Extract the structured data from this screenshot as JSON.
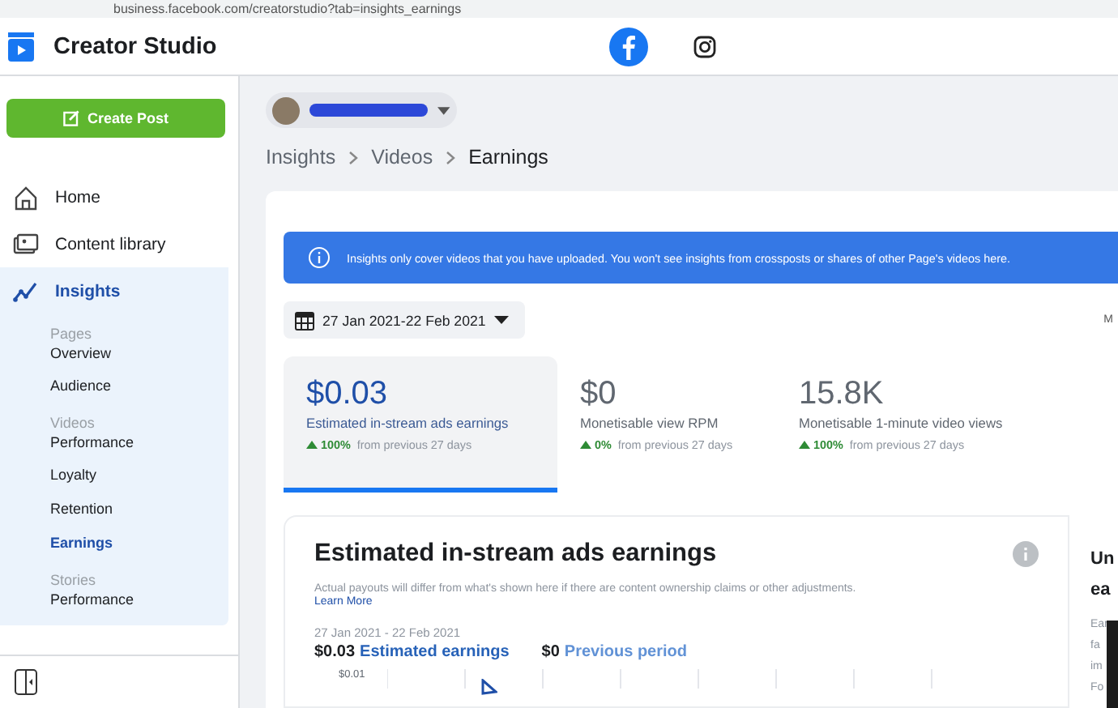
{
  "browser": {
    "url": "business.facebook.com/creatorstudio?tab=insights_earnings"
  },
  "header": {
    "title": "Creator Studio",
    "platforms": [
      {
        "kind": "facebook",
        "selected": true
      },
      {
        "kind": "instagram",
        "selected": false
      }
    ]
  },
  "sidebar": {
    "create_button": "Create Post",
    "nav": [
      {
        "label": "Home",
        "kind": "home",
        "selected": false
      },
      {
        "label": "Content library",
        "kind": "library",
        "selected": false
      },
      {
        "label": "Insights",
        "kind": "insights",
        "selected": true,
        "sections": [
          {
            "heading": "Pages",
            "items": [
              {
                "label": "Overview",
                "selected": false
              },
              {
                "label": "Audience",
                "selected": false
              }
            ]
          },
          {
            "heading": "Videos",
            "items": [
              {
                "label": "Performance",
                "selected": false
              },
              {
                "label": "Loyalty",
                "selected": false
              },
              {
                "label": "Retention",
                "selected": false
              },
              {
                "label": "Earnings",
                "selected": true
              }
            ]
          },
          {
            "heading": "Stories",
            "items": [
              {
                "label": "Performance",
                "selected": false
              }
            ]
          }
        ]
      }
    ]
  },
  "breadcrumbs": [
    {
      "label": "Insights",
      "current": false
    },
    {
      "label": "Videos",
      "current": false
    },
    {
      "label": "Earnings",
      "current": true
    }
  ],
  "banner": "Insights only cover videos that you have uploaded. You won't see insights from crossposts or shares of other Page's videos here.",
  "date_range": "27 Jan 2021-22 Feb 2021",
  "cut_label": "M",
  "metrics": [
    {
      "value": "$0.03",
      "label": "Estimated in-stream ads earnings",
      "change": "100%",
      "change_text": "from previous 27 days",
      "selected": true
    },
    {
      "value": "$0",
      "label": "Monetisable view RPM",
      "change": "0%",
      "change_text": "from previous 27 days",
      "selected": false
    },
    {
      "value": "15.8K",
      "label": "Monetisable 1-minute video views",
      "change": "100%",
      "change_text": "from previous 27 days",
      "selected": false
    }
  ],
  "earnings_card": {
    "title": "Estimated in-stream ads earnings",
    "note": "Actual payouts will differ from what's shown here if there are content ownership claims or other adjustments.",
    "link": "Learn More",
    "period": "27 Jan 2021 - 22 Feb 2021",
    "summary": [
      {
        "value": "$0.03",
        "label": "Estimated earnings",
        "kind": "current"
      },
      {
        "value": "$0",
        "label": "Previous period",
        "kind": "previous"
      }
    ],
    "y_tick": "$0.01"
  },
  "side_panel": {
    "title_lines": [
      "Un",
      "ea"
    ],
    "body_lines": [
      "Ear",
      "fa",
      "im",
      "Fo"
    ]
  }
}
